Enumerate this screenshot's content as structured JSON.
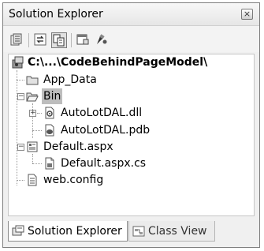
{
  "window": {
    "title": "Solution Explorer",
    "close_glyph": "×"
  },
  "toolbar": {
    "buttons": [
      {
        "name": "properties-icon",
        "active": false
      },
      {
        "name": "refresh-icon",
        "active": false
      },
      {
        "name": "show-all-files-icon",
        "active": true
      },
      {
        "name": "view-code-icon",
        "active": false
      },
      {
        "name": "view-designer-icon",
        "active": false
      }
    ]
  },
  "tree": {
    "root": {
      "label": "C:\\...\\CodeBehindPageModel\\"
    },
    "items": {
      "app_data": "App_Data",
      "bin": "Bin",
      "dll": "AutoLotDAL.dll",
      "pdb": "AutoLotDAL.pdb",
      "default_aspx": "Default.aspx",
      "default_cs": "Default.aspx.cs",
      "web_config": "web.config"
    },
    "selected": "Bin"
  },
  "tabs": [
    {
      "label": "Solution Explorer",
      "active": true,
      "icon": "solution-explorer-icon"
    },
    {
      "label": "Class View",
      "active": false,
      "icon": "class-view-icon"
    }
  ]
}
